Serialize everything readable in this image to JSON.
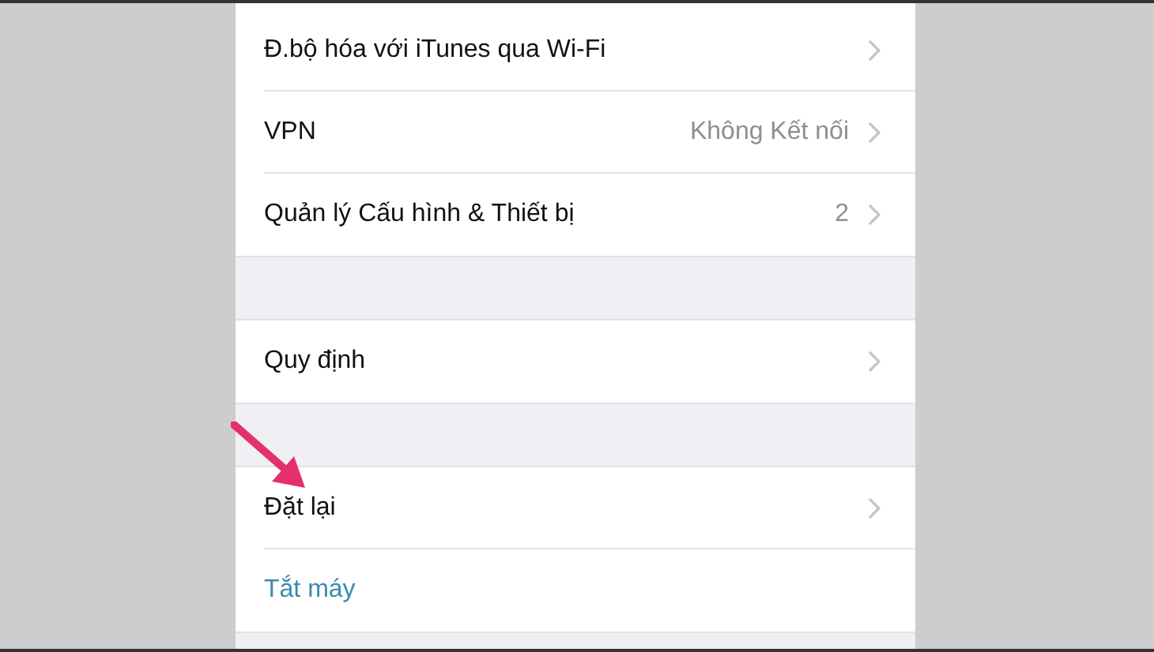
{
  "groups": [
    {
      "rows": [
        {
          "kind": "link",
          "label": "Đ.bộ hóa với iTunes qua Wi-Fi",
          "chevron": true
        },
        {
          "kind": "link",
          "label": "VPN",
          "value": "Không Kết nối",
          "chevron": true
        },
        {
          "kind": "link",
          "label": "Quản lý Cấu hình & Thiết bị",
          "value": "2",
          "chevron": true
        }
      ]
    },
    {
      "rows": [
        {
          "kind": "link",
          "label": "Quy định",
          "chevron": true
        }
      ]
    },
    {
      "rows": [
        {
          "kind": "link",
          "label": "Đặt lại",
          "chevron": true
        },
        {
          "kind": "action",
          "label": "Tắt máy",
          "chevron": false
        }
      ]
    }
  ]
}
